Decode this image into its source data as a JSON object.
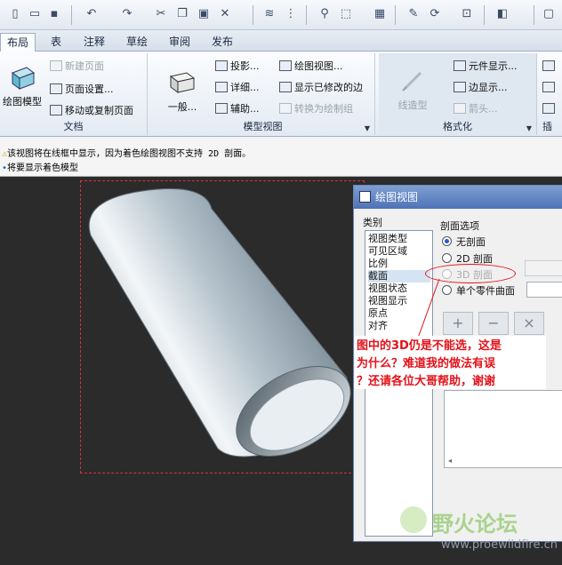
{
  "tabs": [
    {
      "label": "布局",
      "active": true
    },
    {
      "label": "表"
    },
    {
      "label": "注释"
    },
    {
      "label": "草绘"
    },
    {
      "label": "审阅"
    },
    {
      "label": "发布"
    }
  ],
  "ribbon": {
    "doc_group": {
      "title": "文档",
      "big": "绘图模型",
      "items": [
        "新建页面",
        "页面设置...",
        "移动或复制页面"
      ]
    },
    "view_group": {
      "title": "模型视图",
      "big": "一般...",
      "col1": [
        "投影...",
        "详细...",
        "辅助..."
      ],
      "col2": [
        "绘图视图...",
        "显示已修改的边",
        "转换为绘制组"
      ]
    },
    "format_group": {
      "title": "格式化",
      "big": "线造型",
      "items": [
        "元件显示...",
        "边显示...",
        "箭头..."
      ]
    },
    "insert_group": {
      "title": "插"
    }
  },
  "messages": [
    "该视图将在线框中显示，因为着色绘图视图不支持 2D 剖面。",
    "将要显示着色模型"
  ],
  "dialog": {
    "title": "绘图视图",
    "category_label": "类别",
    "categories": [
      "视图类型",
      "可见区域",
      "比例",
      "截面",
      "视图状态",
      "视图显示",
      "原点",
      "对齐"
    ],
    "selected_category": "截面",
    "section_options_label": "剖面选项",
    "options": [
      {
        "label": "无剖面",
        "selected": true,
        "enabled": true
      },
      {
        "label": "2D 剖面",
        "selected": false,
        "enabled": true
      },
      {
        "label": "3D 剖面",
        "selected": false,
        "enabled": false
      },
      {
        "label": "单个零件曲面",
        "selected": false,
        "enabled": true
      }
    ],
    "toolbar": [
      "+",
      "−",
      "×"
    ]
  },
  "annotation": {
    "lines": [
      "图中的3D仍是不能选，这是",
      "为什么？难道我的做法有误",
      "？还请各位大哥帮助，谢谢"
    ]
  },
  "watermark": {
    "text": "野火论坛",
    "url": "www.proewildfire.cn"
  }
}
